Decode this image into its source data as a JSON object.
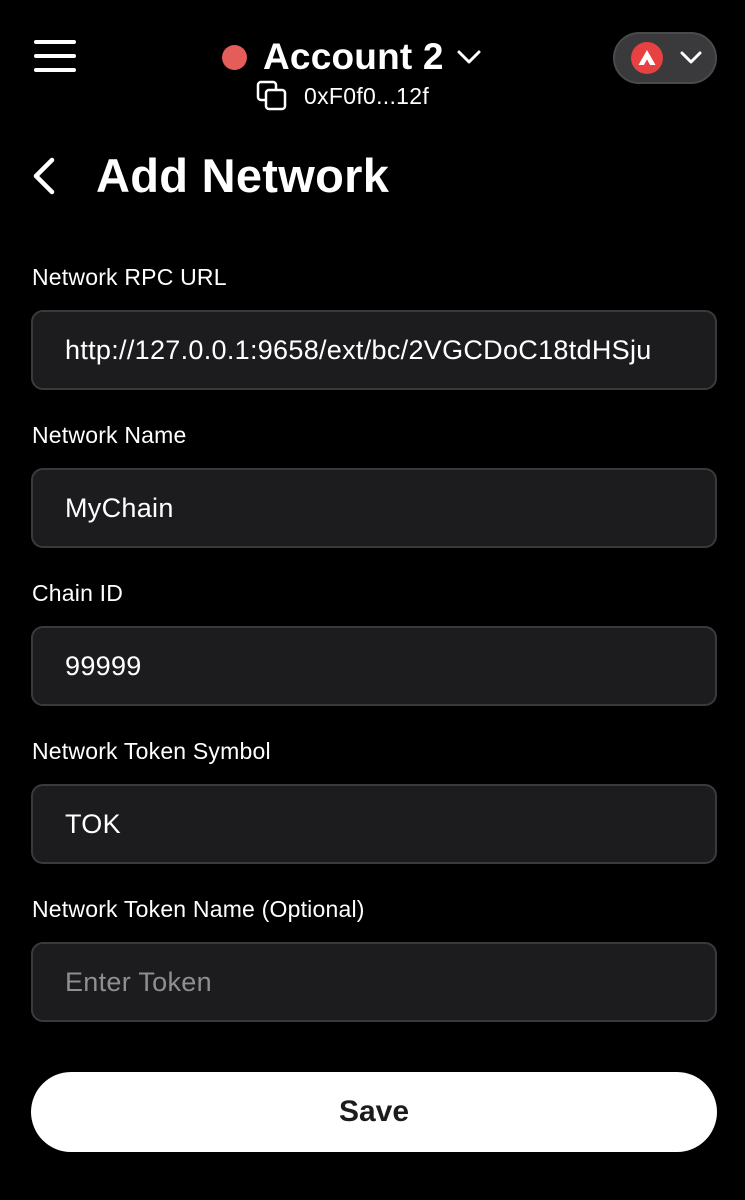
{
  "header": {
    "account_name": "Account 2",
    "address": "0xF0f0...12f",
    "status_color": "#e35d5b",
    "network_icon": "avalanche-logo",
    "network_color": "#e84142"
  },
  "page": {
    "title": "Add Network"
  },
  "form": {
    "rpc_url": {
      "label": "Network RPC URL",
      "value": "http://127.0.0.1:9658/ext/bc/2VGCDoC18tdHSju"
    },
    "network_name": {
      "label": "Network Name",
      "value": "MyChain"
    },
    "chain_id": {
      "label": "Chain ID",
      "value": "99999"
    },
    "token_symbol": {
      "label": "Network Token Symbol",
      "value": "TOK"
    },
    "token_name": {
      "label": "Network Token Name (Optional)",
      "placeholder": "Enter Token",
      "value": ""
    }
  },
  "actions": {
    "save_label": "Save"
  }
}
